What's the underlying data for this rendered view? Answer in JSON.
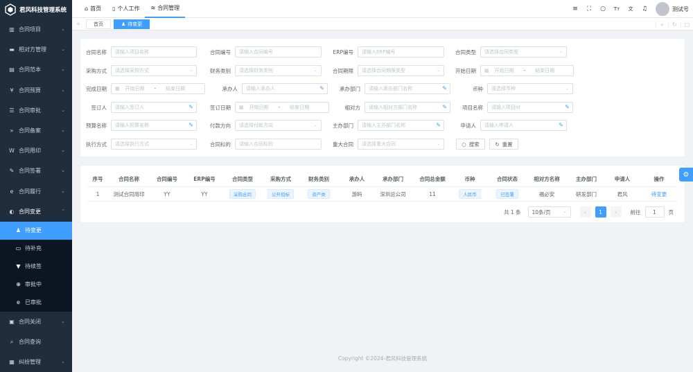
{
  "app": {
    "title": "君风科技管理系统"
  },
  "sidebar": {
    "items": [
      {
        "label": "合同项目",
        "icon": "building-icon",
        "glyph": "▥"
      },
      {
        "label": "相对方管理",
        "icon": "bed-icon",
        "glyph": "▬"
      },
      {
        "label": "合同范本",
        "icon": "document-icon",
        "glyph": "▤"
      },
      {
        "label": "合同预算",
        "icon": "yen-icon",
        "glyph": "¥"
      },
      {
        "label": "合同审批",
        "icon": "list-icon",
        "glyph": "☰"
      },
      {
        "label": "合同备案",
        "icon": "fast-forward-icon",
        "glyph": "»"
      },
      {
        "label": "合同用印",
        "icon": "wordpress-icon",
        "glyph": "W"
      },
      {
        "label": "合同签署",
        "icon": "pen-icon",
        "glyph": "✎"
      },
      {
        "label": "合同履行",
        "icon": "edge-icon",
        "glyph": "e"
      },
      {
        "label": "合同变更",
        "icon": "half-circle-icon",
        "glyph": "◐"
      }
    ],
    "sub_items": [
      {
        "label": "待变更",
        "icon": "user-icon",
        "glyph": "♟",
        "active": true
      },
      {
        "label": "待补充",
        "icon": "tablet-icon",
        "glyph": "▭"
      },
      {
        "label": "待续签",
        "icon": "stamp-icon",
        "glyph": "▼"
      },
      {
        "label": "审批中",
        "icon": "lifebuoy-icon",
        "glyph": "⊕"
      },
      {
        "label": "已审批",
        "icon": "ie-icon",
        "glyph": "e"
      }
    ],
    "bottom_items": [
      {
        "label": "合同关闭",
        "icon": "window-icon",
        "glyph": "▣"
      },
      {
        "label": "合同查询",
        "icon": "search-icon",
        "glyph": "⌕"
      },
      {
        "label": "纠纷管理",
        "icon": "briefcase-icon",
        "glyph": "▦"
      }
    ]
  },
  "header": {
    "tabs": [
      {
        "label": "首页",
        "icon": "home-icon",
        "glyph": "⌂"
      },
      {
        "label": "个人工作",
        "icon": "trash-icon",
        "glyph": "▯"
      },
      {
        "label": "合同管理",
        "icon": "database-icon",
        "glyph": "≋"
      }
    ],
    "icons": [
      {
        "name": "menu-icon",
        "glyph": "≡"
      },
      {
        "name": "fullscreen-icon",
        "glyph": "⛶"
      },
      {
        "name": "search-icon",
        "glyph": "○"
      },
      {
        "name": "font-size-icon",
        "glyph": "Tт"
      },
      {
        "name": "translate-icon",
        "glyph": "文"
      },
      {
        "name": "bell-icon",
        "glyph": "♫"
      }
    ],
    "user": "测试号"
  },
  "tagsview": {
    "tabs": [
      {
        "label": "首页"
      },
      {
        "label": "待变更"
      }
    ]
  },
  "form": {
    "contract_name": {
      "label": "合同名称",
      "placeholder": "请输入项目名称"
    },
    "contract_no": {
      "label": "合同编号",
      "placeholder": "请输入合同编号"
    },
    "erp_no": {
      "label": "ERP编号",
      "placeholder": "请输入ERP编号"
    },
    "contract_type": {
      "label": "合同类型",
      "placeholder": "请选择合同类型"
    },
    "purchase_method": {
      "label": "采购方式",
      "placeholder": "请选择采购方式"
    },
    "finance_category": {
      "label": "财务类别",
      "placeholder": "请选择财务类别"
    },
    "contract_term": {
      "label": "合同期限",
      "placeholder": "请选择合同期限类型"
    },
    "start_date": {
      "label": "开始日期",
      "from": "开始日期",
      "dash": "-",
      "to": "结束日期"
    },
    "end_date": {
      "label": "完成日期",
      "from": "开始日期",
      "dash": "-",
      "to": "结束日期"
    },
    "handler": {
      "label": "承办人",
      "placeholder": "请输入承办人"
    },
    "dept": {
      "label": "承办部门",
      "placeholder": "请输入承办部门名称"
    },
    "currency": {
      "label": "币种",
      "placeholder": "请选择币种"
    },
    "signer": {
      "label": "签订人",
      "placeholder": "请输入签订人"
    },
    "sign_date": {
      "label": "签订日期",
      "from": "开始日期",
      "dash": "-",
      "to": "结束日期"
    },
    "counterparty": {
      "label": "相对方",
      "placeholder": "请输入相对方部门名称"
    },
    "project_name": {
      "label": "项目名称",
      "placeholder": "请输入项目id"
    },
    "budget_name": {
      "label": "预算名称",
      "placeholder": "请输入预算名称"
    },
    "pay_direction": {
      "label": "付款方向",
      "placeholder": "请选择付款方向"
    },
    "host_dept": {
      "label": "主办部门",
      "placeholder": "请输入主办部门名称"
    },
    "applicant": {
      "label": "申请人",
      "placeholder": "请输入申请人"
    },
    "exec_method": {
      "label": "执行方式",
      "placeholder": "请选择执行方式"
    },
    "subject": {
      "label": "合同标的",
      "placeholder": "请输入合同标的"
    },
    "major": {
      "label": "重大合同",
      "placeholder": "请选择重大合同"
    },
    "search_btn": "搜索",
    "reset_btn": "重置"
  },
  "table": {
    "headers": [
      "序号",
      "合同名称",
      "合同编号",
      "ERP编号",
      "合同类型",
      "采购方式",
      "财务类别",
      "承办人",
      "承办部门",
      "合同总金额",
      "币种",
      "合同状态",
      "相对方名称",
      "主办部门",
      "申请人",
      "操作"
    ],
    "rows": [
      [
        "1",
        "测试合同用印",
        "YY",
        "YY",
        "采购合同",
        "公开招标",
        "资产类",
        "游码",
        "深圳总公司",
        "11",
        "人民币",
        "已签署",
        "福必安",
        "研发部门",
        "君风",
        "待变更"
      ]
    ]
  },
  "pagination": {
    "total": "共 1 条",
    "page_size": "10条/页",
    "prev": "‹",
    "current": "1",
    "next": "›",
    "goto_label": "前往",
    "goto_value": "1",
    "page_label": "页"
  },
  "footer": "Copyright ©2024-君风科技管理系统",
  "colors": {
    "primary": "#409eff",
    "sidebar": "#1f2d3d",
    "submenu": "#0c1622"
  }
}
